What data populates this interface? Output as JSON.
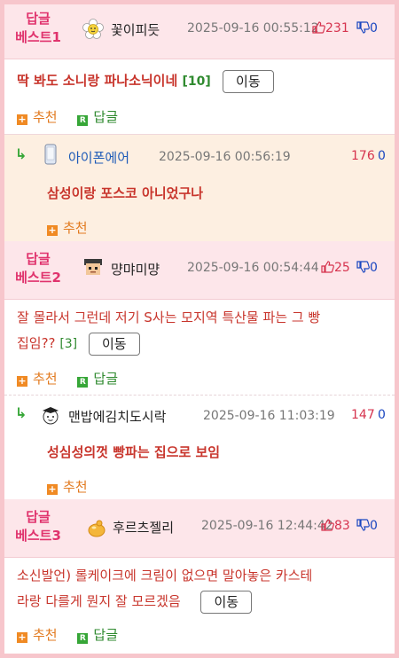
{
  "comments": [
    {
      "rank_line1": "답글",
      "rank_line2": "베스트1",
      "avatar": "flower-avatar-icon",
      "nick": "꽃이피듯",
      "date": "2025-09-16 00:55:12",
      "up": "231",
      "down": "0",
      "text": "딱 봐도 소니랑 파나소닉이네",
      "reply_count": "[10]",
      "move_label": "이동",
      "recommend_label": "추천",
      "reply_label": "답글",
      "reply": {
        "avatar": "phone-avatar-icon",
        "nick": "아이폰에어",
        "date": "2025-09-16 00:56:19",
        "up": "176",
        "down": "0",
        "text": "삼성이랑 포스코 아니었구나",
        "recommend_label": "추천"
      }
    },
    {
      "rank_line1": "답글",
      "rank_line2": "베스트2",
      "avatar": "pixel-person-avatar-icon",
      "nick": "먕먀미먕",
      "date": "2025-09-16 00:54:44",
      "up": "25",
      "down": "0",
      "text_line1": "잘 몰라서 그런데 저기 S사는 모지역 특산물 파는 그 빵",
      "text_line2": "집임??",
      "reply_count": "[3]",
      "move_label": "이동",
      "recommend_label": "추천",
      "reply_label": "답글",
      "reply": {
        "avatar": "graduate-avatar-icon",
        "nick": "맨밥에김치도시락",
        "date": "2025-09-16 11:03:19",
        "up": "147",
        "down": "0",
        "text": "성심성의껏 빵파는 집으로 보임",
        "recommend_label": "추천"
      }
    },
    {
      "rank_line1": "답글",
      "rank_line2": "베스트3",
      "avatar": "jelly-avatar-icon",
      "nick": "후르츠젤리",
      "date": "2025-09-16 12:44:42",
      "up": "83",
      "down": "0",
      "text_line1": "소신발언) 롤케이크에 크림이 없으면 말아놓은 카스테",
      "text_line2": "라랑 다를게 뭔지 잘 모르겠음",
      "move_label": "이동",
      "recommend_label": "추천",
      "reply_label": "답글"
    }
  ]
}
